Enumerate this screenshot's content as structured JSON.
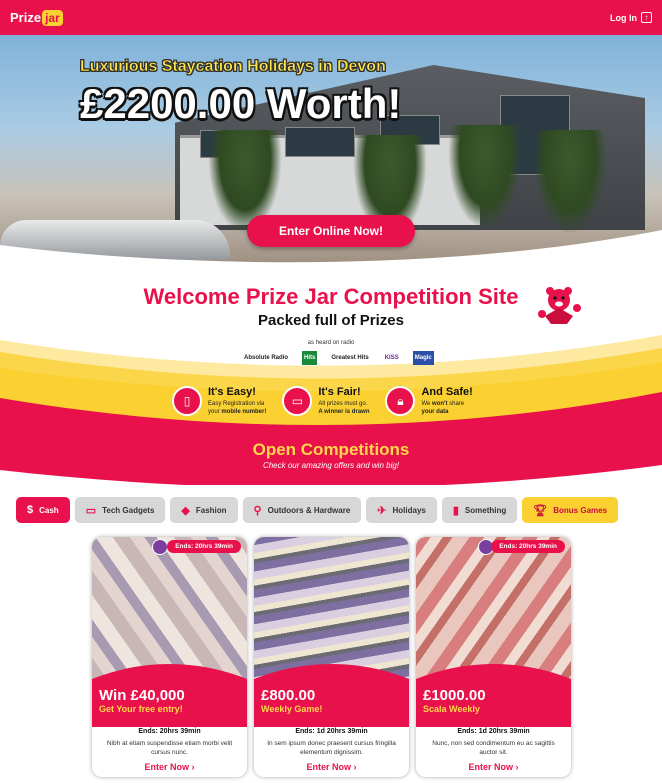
{
  "header": {
    "logo_text": "Prize",
    "logo_jar": "jar",
    "login_label": "Log In",
    "login_icon": "login-arrow-icon"
  },
  "hero": {
    "subtitle": "Luxurious Staycation Holidays in Devon",
    "title": "£2200.00 Worth!",
    "cta_label": "Enter Online Now!"
  },
  "welcome": {
    "title": "Welcome Prize Jar Competition Site",
    "subtitle": "Packed full of Prizes"
  },
  "radio": {
    "label": "as heard on radio",
    "stations": [
      "Absolute Radio",
      "Hits",
      "Greatest Hits",
      "KISS",
      "Magic"
    ]
  },
  "features": [
    {
      "title": "It's Easy!",
      "line1": "Easy Registration via",
      "line2_plain": "your ",
      "line2_bold": "mobile number!",
      "icon": "phone-icon"
    },
    {
      "title": "It's Fair!",
      "line1": "All prizes must go.",
      "line2_plain": "",
      "line2_bold": "A winner is drawn",
      "icon": "ticket-icon"
    },
    {
      "title": "And Safe!",
      "line1_plain": "We ",
      "line1_bold": "won't",
      "line1_rest": " share",
      "line2_plain": "",
      "line2_bold": "your data",
      "icon": "lock-user-icon"
    }
  ],
  "open": {
    "title": "Open Competitions",
    "subtitle": "Check our amazing offers and win big!"
  },
  "tabs": [
    {
      "label": "Cash",
      "icon": "cash-icon",
      "active": true
    },
    {
      "label": "Tech Gadgets",
      "icon": "monitor-icon"
    },
    {
      "label": "Fashion",
      "icon": "bag-icon"
    },
    {
      "label": "Outdoors & Hardware",
      "icon": "bike-icon"
    },
    {
      "label": "Holidays",
      "icon": "plane-icon"
    },
    {
      "label": "Something",
      "icon": "bottle-icon"
    },
    {
      "label": "Bonus Games",
      "icon": "trophy-icon",
      "bonus": true
    }
  ],
  "cards": [
    {
      "badge": "Ends: 20hrs 39min",
      "price": "Win £40,000",
      "sub": "Get Your free entry!",
      "ends": "Ends: 20hrs 39min",
      "desc": "Nibh at etiam suspendisse etiam morbi velit cursus nunc.",
      "enter": "Enter Now ›"
    },
    {
      "badge": "",
      "price": "£800.00",
      "sub": "Weekly Game!",
      "ends": "Ends: 1d 20hrs 39min",
      "desc": "In sem ipsum donec praesent cursus fringilla elementum dignissim.",
      "enter": "Enter Now ›"
    },
    {
      "badge": "Ends: 20hrs 39min",
      "price": "£1000.00",
      "sub": "Scala Weekly",
      "ends": "Ends: 1d 20hrs 39min",
      "desc": "Nunc, non sed condimentum eu ac sagittis auctor sit.",
      "enter": "Enter Now ›"
    }
  ],
  "colors": {
    "brand": "#e8114b",
    "accent": "#fbd131"
  }
}
